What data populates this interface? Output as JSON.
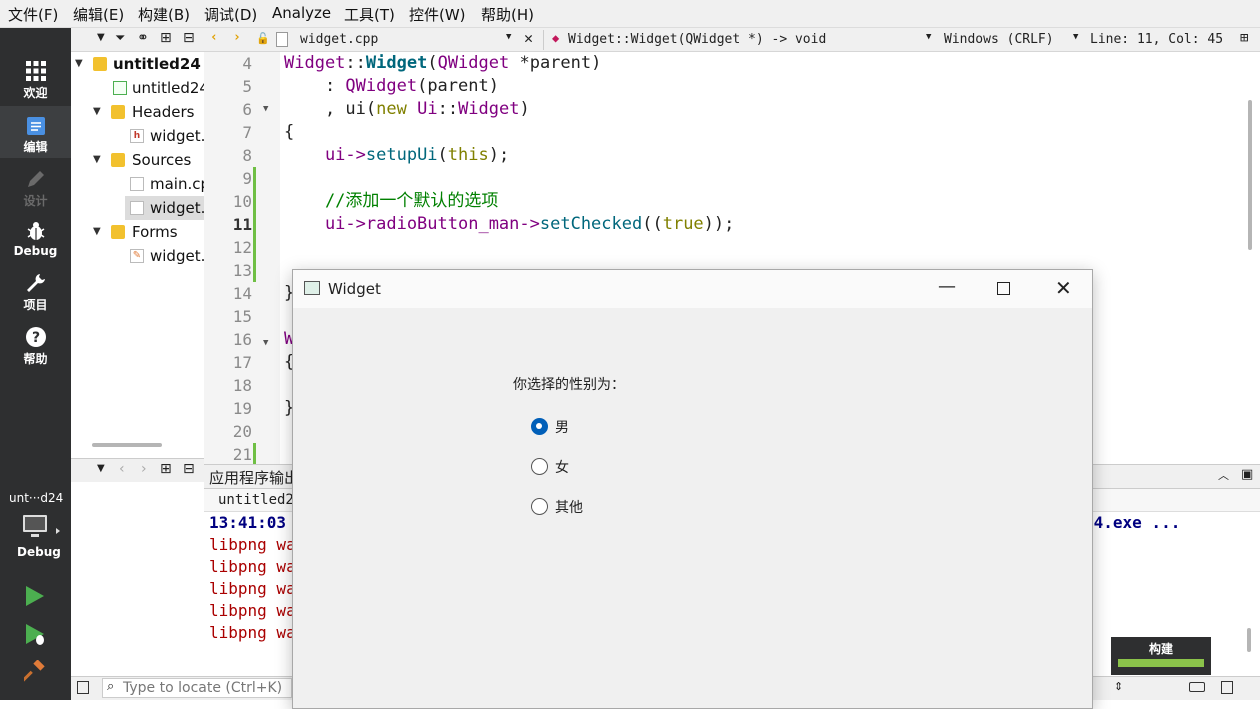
{
  "menu": [
    "文件(F)",
    "编辑(E)",
    "构建(B)",
    "调试(D)",
    "Analyze",
    "工具(T)",
    "控件(W)",
    "帮助(H)"
  ],
  "modes": {
    "welcome": "欢迎",
    "edit": "编辑",
    "design": "设计",
    "debug": "Debug",
    "project": "项目",
    "help": "帮助"
  },
  "kit": {
    "name": "unt···d24",
    "mode": "Debug"
  },
  "tree": {
    "project": "untitled24",
    "pro_file": "untitled24",
    "headers": "Headers",
    "header_file": "widget.",
    "sources": "Sources",
    "source_main": "main.cp",
    "source_widget": "widget.",
    "forms": "Forms",
    "form_file": "widget."
  },
  "editor": {
    "file": "widget.cpp",
    "symbol": "Widget::Widget(QWidget *) -> void",
    "encoding": "Windows (CRLF)",
    "position": "Line: 11, Col: 45"
  },
  "line_numbers": [
    "4",
    "5",
    "6",
    "7",
    "8",
    "9",
    "10",
    "11",
    "12",
    "13",
    "14",
    "15",
    "16",
    "17",
    "18",
    "19",
    "20",
    "21"
  ],
  "code": {
    "l4_class": "Widget",
    "l4_sep": "::",
    "l4_ctor": "Widget",
    "l4_open": "(",
    "l4_type": "QWidget",
    "l4_rest": " *parent)",
    "l5_pre": "    : ",
    "l5_base": "QWidget",
    "l5_rest": "(parent)",
    "l6_pre": "    , ui(",
    "l6_new": "new",
    "l6_sp": " ",
    "l6_ns": "Ui",
    "l6_sep": "::",
    "l6_type": "Widget",
    "l6_close": ")",
    "l7": "{",
    "l8_pre": "    ui->",
    "l8_fn": "setupUi",
    "l8_open": "(",
    "l8_this": "this",
    "l8_close": ");",
    "l10_comment": "    //添加一个默认的选项",
    "l11_pre": "    ui->radioButton_man->",
    "l11_fn": "setChecked",
    "l11_open": "((",
    "l11_true": "true",
    "l11_close": "));",
    "l14": "}",
    "l16": "W",
    "l17": "{",
    "l19": "}"
  },
  "output": {
    "pane_title": "应用程序输出",
    "tab": "untitled23",
    "time": "13:41:03",
    "exe_tail": "24.exe ...",
    "lines": [
      "libpng wa",
      "libpng wa",
      "libpng wa",
      "libpng wa",
      "libpng wa"
    ]
  },
  "locator_placeholder": "Type to locate (Ctrl+K)",
  "build_label": "构建",
  "dialog": {
    "title": "Widget",
    "prompt": "你选择的性别为：",
    "options": [
      "男",
      "女",
      "其他"
    ],
    "selected_index": 0
  },
  "colors": {
    "mode_bar": "#2e2f30",
    "radio_accent": "#005fb8",
    "output_red": "#aa0000",
    "output_blue": "#000080",
    "build_progress": "#8bc34a"
  }
}
